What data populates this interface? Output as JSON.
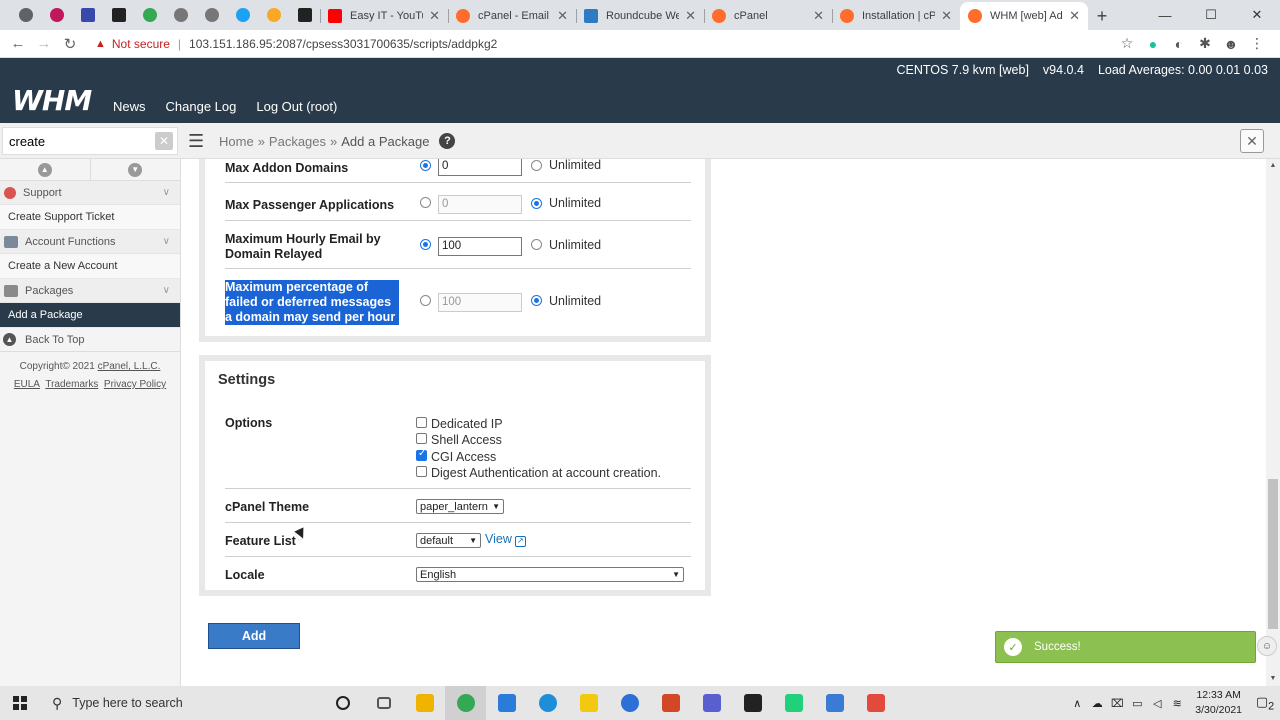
{
  "browser": {
    "tabs": [
      {
        "label": "Easy IT - YouTube",
        "color": "#ff0000"
      },
      {
        "label": "cPanel - Email Ac",
        "color": "#ff6c2c"
      },
      {
        "label": "Roundcube Webm",
        "color": "#2e7bc4"
      },
      {
        "label": "cPanel",
        "color": "#ff6c2c"
      },
      {
        "label": "Installation | cPan",
        "color": "#ff6c2c"
      },
      {
        "label": "WHM [web] Add",
        "color": "#ff6c2c"
      }
    ],
    "pinned_colors": [
      "#5f6368",
      "#c2185b",
      "#3949ab",
      "#222222",
      "#34a853",
      "#777777",
      "#777777",
      "#1da1f2",
      "#f9a825",
      "#222222"
    ],
    "not_secure": "Not secure",
    "url": "103.151.186.95:2087/cpsess3031700635/scripts/addpkg2"
  },
  "whm": {
    "logo": "WHM",
    "nav": [
      "News",
      "Change Log",
      "Log Out (root)"
    ],
    "server": "CENTOS 7.9 kvm [web]",
    "version": "v94.0.4",
    "load": "Load Averages: 0.00 0.01 0.03"
  },
  "crumb": {
    "search_value": "create",
    "home": "Home",
    "packages": "Packages",
    "current": "Add a Package",
    "sep": "»"
  },
  "sidebar": {
    "support": "Support",
    "create_ticket": "Create Support Ticket",
    "account_functions": "Account Functions",
    "create_account": "Create a New Account",
    "packages": "Packages",
    "add_package": "Add a Package",
    "back_to_top": "Back To Top",
    "copyright": "Copyright© 2021",
    "company": "cPanel, L.L.C.",
    "eula": "EULA",
    "trademarks": "Trademarks",
    "privacy": "Privacy Policy"
  },
  "limits": {
    "addon_label": "Max Addon Domains",
    "addon_value": "0",
    "passenger_label": "Max Passenger Applications",
    "passenger_value": "0",
    "hourly_label": "Maximum Hourly Email by Domain Relayed",
    "hourly_value": "100",
    "percent_label": "Maximum percentage of failed or deferred messages a domain may send per hour",
    "percent_value": "100",
    "unlimited": "Unlimited"
  },
  "settings": {
    "title": "Settings",
    "options_label": "Options",
    "options": [
      {
        "label": "Dedicated IP",
        "checked": false
      },
      {
        "label": "Shell Access",
        "checked": false
      },
      {
        "label": "CGI Access",
        "checked": true
      },
      {
        "label": "Digest Authentication at account creation.",
        "checked": false
      }
    ],
    "theme_label": "cPanel Theme",
    "theme_value": "paper_lantern",
    "feature_label": "Feature List",
    "feature_value": "default",
    "view_link": "View",
    "locale_label": "Locale",
    "locale_value": "English"
  },
  "add_button": "Add",
  "toast": "Success!",
  "taskbar": {
    "search": "Type here to search",
    "time": "12:33 AM",
    "date": "3/30/2021",
    "notif_count": "2",
    "icon_colors": [
      "#222222",
      "#555555",
      "#f0b400",
      "#34a853",
      "#2b7bd8",
      "#1f8ed8",
      "#f2c811",
      "#2c6fd6",
      "#d24726",
      "#5a5fd0",
      "#222222",
      "#21d07a",
      "#3a7bd5",
      "#e24a3b"
    ]
  }
}
